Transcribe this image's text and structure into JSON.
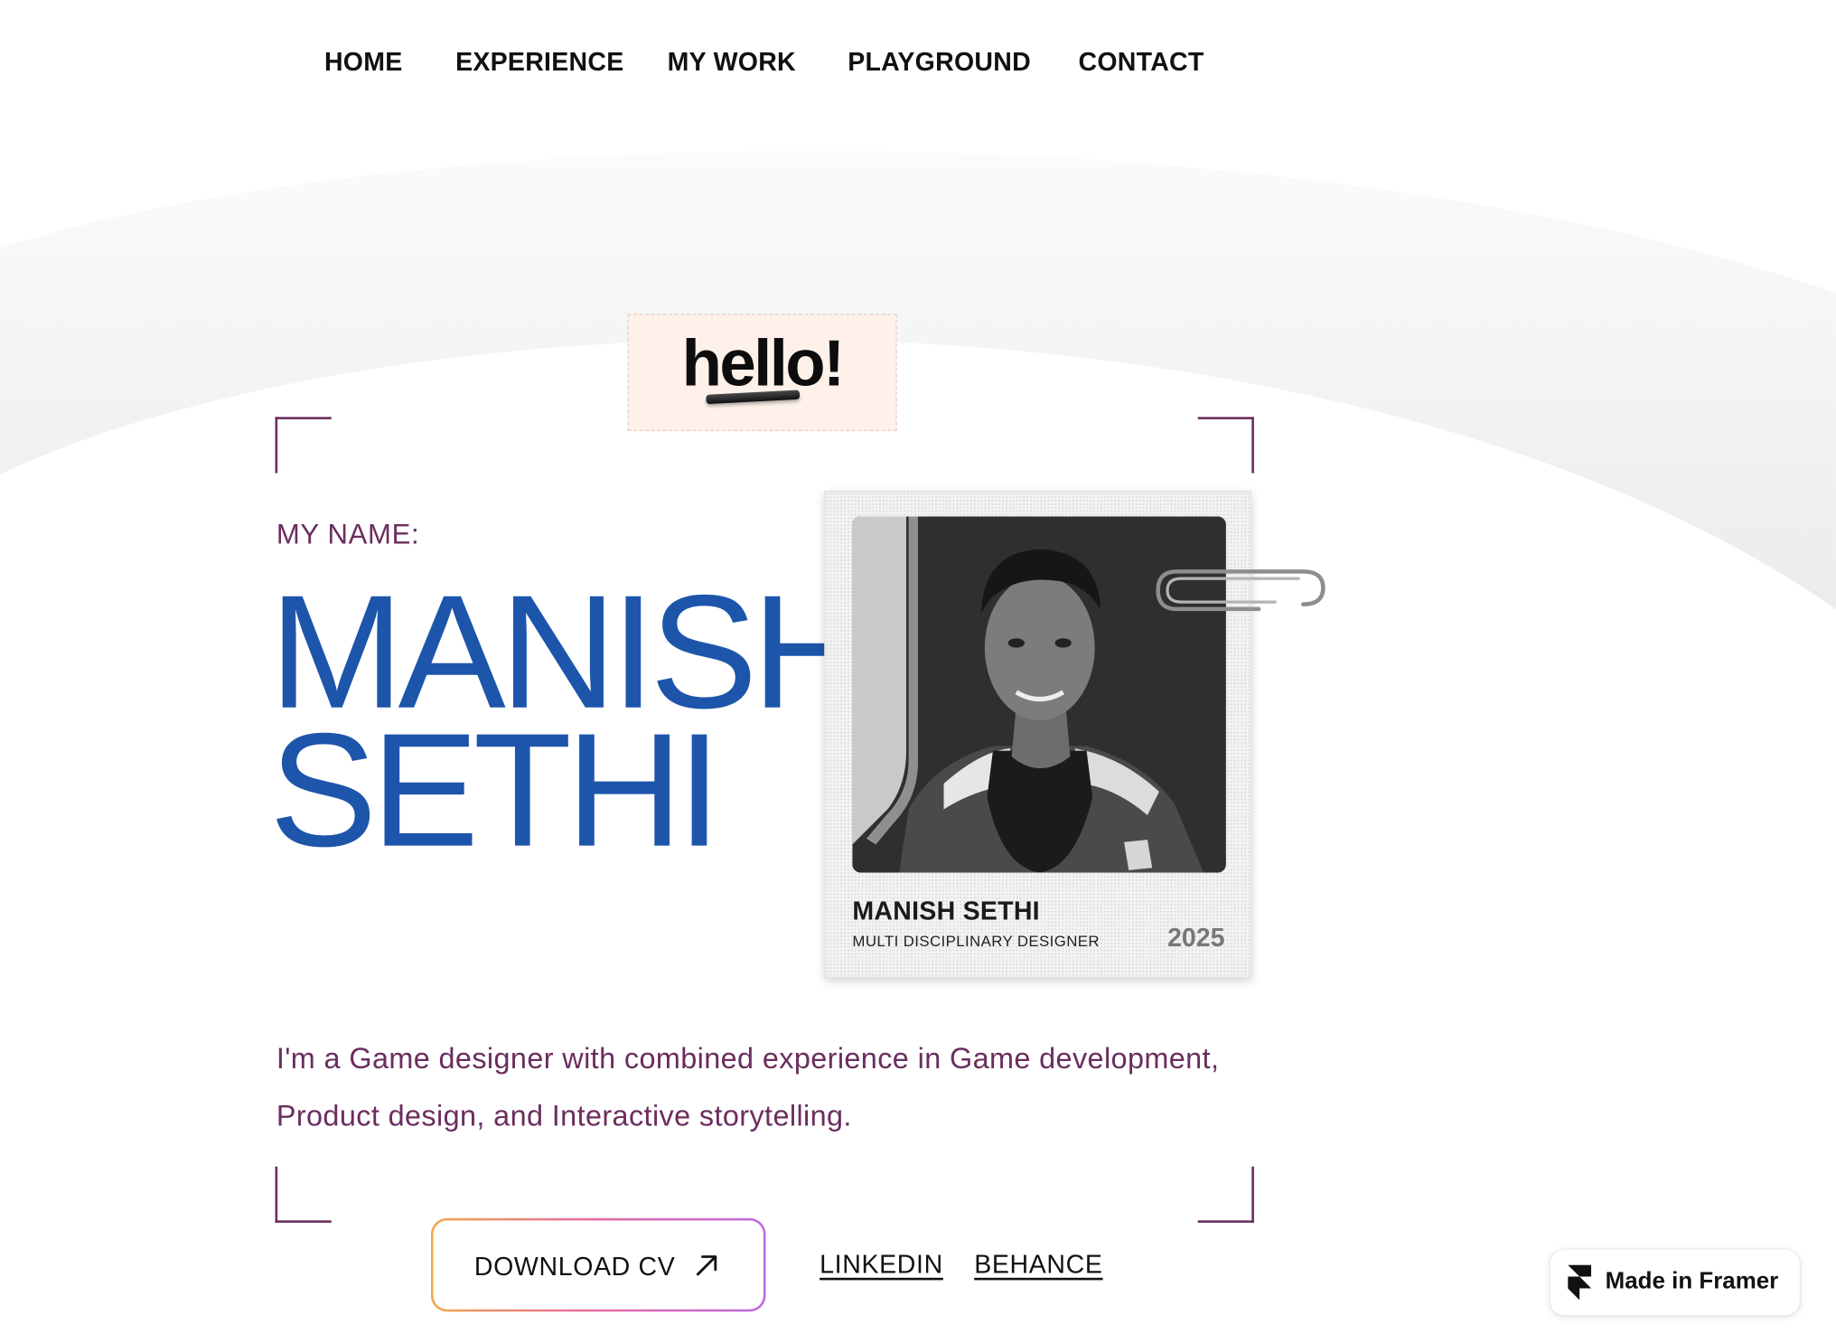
{
  "nav": {
    "items": [
      {
        "label": "HOME"
      },
      {
        "label": "EXPERIENCE"
      },
      {
        "label": "MY WORK"
      },
      {
        "label": "PLAYGROUND"
      },
      {
        "label": "CONTACT"
      }
    ]
  },
  "hero": {
    "sticker_text": "hello!",
    "name_label": "MY NAME:",
    "first_name": "MANISH",
    "last_name": "SETHI",
    "bio": "I'm a Game designer with combined experience in Game development, Product design, and Interactive storytelling."
  },
  "card": {
    "name": "MANISH SETHI",
    "role": "MULTI DISCIPLINARY DESIGNER",
    "year": "2025"
  },
  "actions": {
    "download_cv": "DOWNLOAD CV",
    "linkedin": "LINKEDIN",
    "behance": "BEHANCE"
  },
  "badge": {
    "label": "Made in Framer"
  },
  "colors": {
    "name_blue": "#1d55ab",
    "accent_plum": "#6b2d5e",
    "sticker_bg": "#fdf1ea"
  }
}
